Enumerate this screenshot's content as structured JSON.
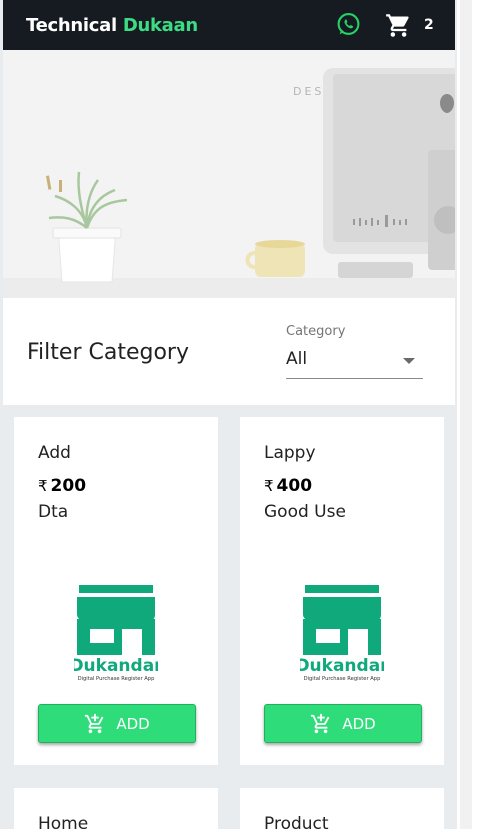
{
  "header": {
    "brand_first": "Technical",
    "brand_second": "Dukaan",
    "cart_count": "2"
  },
  "filter": {
    "title": "Filter Category",
    "category_label": "Category",
    "category_value": "All"
  },
  "products": [
    {
      "name": "Add",
      "currency": "₹",
      "price": "200",
      "description": "Dta",
      "button_label": "ADD",
      "logo_title": "Dukandar",
      "logo_subtitle": "Digital Purchase Register App"
    },
    {
      "name": "Lappy",
      "currency": "₹",
      "price": "400",
      "description": "Good Use",
      "button_label": "ADD",
      "logo_title": "Dukandar",
      "logo_subtitle": "Digital Purchase Register App"
    },
    {
      "name": "Home"
    },
    {
      "name": "Product"
    }
  ],
  "icons": {
    "whatsapp": "whatsapp-icon",
    "cart": "cart-icon",
    "add_cart": "add-to-cart-icon",
    "select_arrow": "dropdown-arrow-icon"
  },
  "colors": {
    "header_bg": "#151b21",
    "brand_accent": "#3ddc84",
    "button_bg": "#2fdc7a",
    "logo_green": "#0fa97b",
    "page_bg": "#e9ecee"
  }
}
